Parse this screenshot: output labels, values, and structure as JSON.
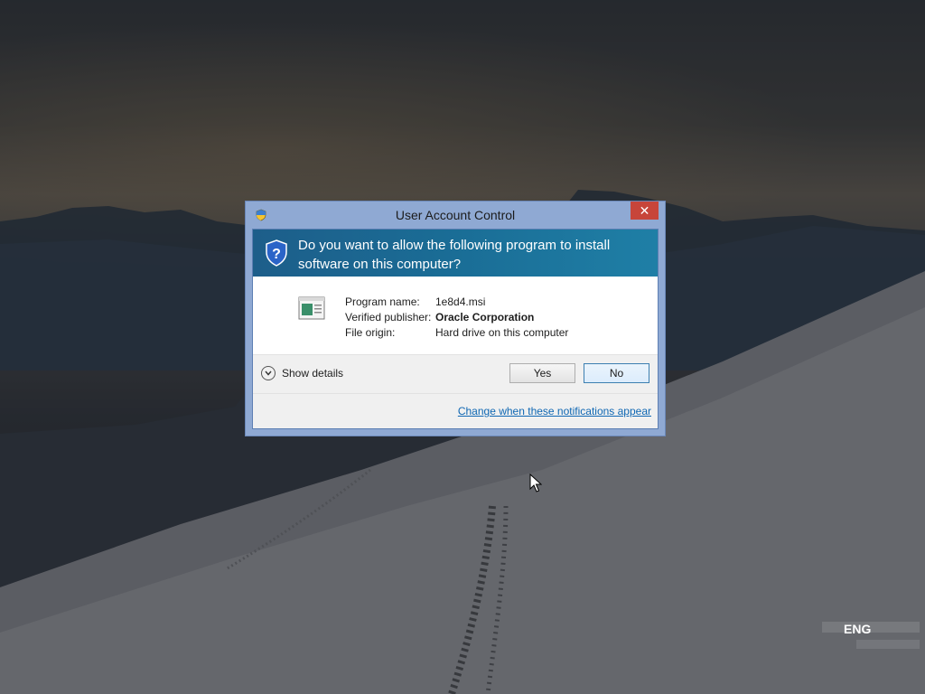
{
  "dialog": {
    "title": "User Account Control",
    "close_label": "✕",
    "question": "Do you want to allow the following program to install software on this computer?",
    "info": [
      {
        "label": "Program name:",
        "value": "1e8d4.msi",
        "bold": false
      },
      {
        "label": "Verified publisher:",
        "value": "Oracle Corporation",
        "bold": true
      },
      {
        "label": "File origin:",
        "value": "Hard drive on this computer",
        "bold": false
      }
    ],
    "show_details_label": "Show details",
    "yes_label": "Yes",
    "no_label": "No",
    "change_link": "Change when these notifications appear"
  },
  "taskbar": {
    "language": "ENG"
  },
  "colors": {
    "banner": "#1a6d96",
    "close": "#c7453a",
    "link": "#0f67b3",
    "frame": "#8fa9d3"
  },
  "icons": {
    "title_icon": "shield-icon",
    "banner_icon": "shield-icon",
    "program_icon": "installer-package-icon",
    "details_icon": "chevron-down-icon",
    "cursor_icon": "mouse-pointer-icon"
  }
}
